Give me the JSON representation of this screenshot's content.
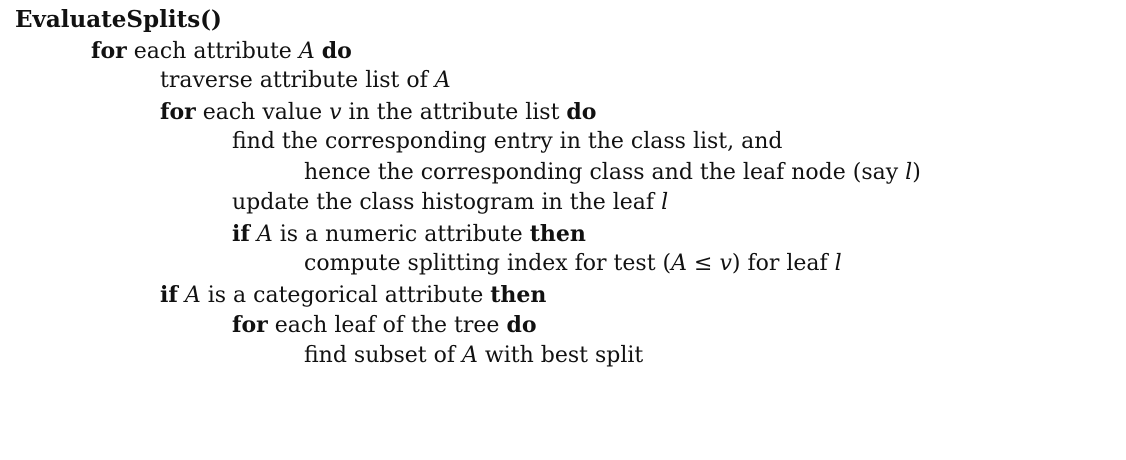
{
  "title": "EvaluateSplits()",
  "lines": [
    {
      "kw": "for",
      "t1": " each attribute ",
      "v1": "A",
      "t2": " ",
      "kw2": "do"
    },
    {
      "t": "traverse attribute list of ",
      "v": "A"
    },
    {
      "kw": "for",
      "t1": " each value ",
      "v1": "v",
      "t2": " in the attribute list ",
      "kw2": "do"
    },
    {
      "t": "find the corresponding entry in the class list, and"
    },
    {
      "t": "hence the corresponding class and the leaf node (say ",
      "v": "l",
      "t2": ")"
    },
    {
      "t": "update the class histogram in the leaf ",
      "v": "l"
    },
    {
      "kw": "if",
      "t1": " ",
      "v1": "A",
      "t2": " is a numeric attribute ",
      "kw2": "then"
    },
    {
      "t": "compute splitting index for test (",
      "v": "A",
      "t2": " ≤ ",
      "v2": "v",
      "t3": ") for leaf ",
      "v3": "l"
    },
    {
      "kw": "if",
      "t1": " ",
      "v1": "A",
      "t2": " is a categorical attribute ",
      "kw2": "then"
    },
    {
      "kw": "for",
      "t1": " each leaf of the tree ",
      "kw2": "do"
    },
    {
      "t": "find subset of ",
      "v": "A",
      "t2": " with best split"
    }
  ]
}
